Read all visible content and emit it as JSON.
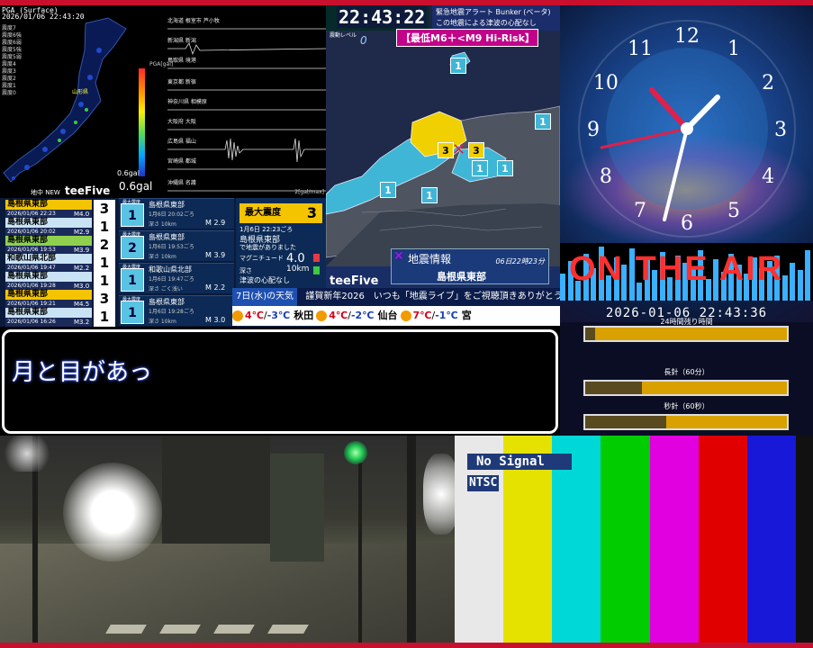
{
  "seismometer": {
    "title": "PGA (Surface)",
    "date": "2026/01/06 22:43:20",
    "legend": [
      "震度7",
      "震度6強",
      "震度6弱",
      "震度5強",
      "震度5弱",
      "震度4",
      "震度3",
      "震度2",
      "震度1",
      "震度0"
    ],
    "scale_label": "PGA[gal]",
    "gal_min": "0.6gal",
    "gal_main": "0.6gal",
    "map_label": "地中 NEW",
    "brand": "teeFive",
    "unit": "2[gal/max]",
    "stations": [
      "北海道 根室市 芦小牧",
      "新潟県 新潟",
      "鳥取県 境港",
      "東京都 新宿",
      "神奈川県 相模原",
      "大阪府 大阪",
      "広島県 福山",
      "宮崎県 都城",
      "沖縄県 名護"
    ]
  },
  "eq_list": [
    {
      "place": "島根県東部",
      "time": "2026/01/06 22:23",
      "mag": "M4.0",
      "intensity": "3",
      "color": "#f5c400"
    },
    {
      "place": "島根県東部",
      "time": "2026/01/06 20:02",
      "mag": "M2.9",
      "intensity": "1",
      "color": "#c9e3f5"
    },
    {
      "place": "島根県東部",
      "time": "2026/01/06 19:53",
      "mag": "M3.9",
      "intensity": "2",
      "color": "#8fd14f"
    },
    {
      "place": "和歌山県北部",
      "time": "2026/01/06 19:47",
      "mag": "M2.2",
      "intensity": "1",
      "color": "#c9e3f5"
    },
    {
      "place": "島根県東部",
      "time": "2026/01/06 19:28",
      "mag": "M3.0",
      "intensity": "1",
      "color": "#c9e3f5"
    },
    {
      "place": "島根県東部",
      "time": "2026/01/06 19:21",
      "mag": "M4.5",
      "intensity": "3",
      "color": "#f5c400"
    },
    {
      "place": "島根県東部",
      "time": "2026/01/06 16:26",
      "mag": "M3.2",
      "intensity": "1",
      "color": "#c9e3f5"
    }
  ],
  "cards": [
    {
      "label": "最大震度",
      "badge": "1",
      "place": "島根県東部",
      "time": "1月6日 20:02ごろ",
      "depth": "深さ  10km",
      "mag": "M 2.9"
    },
    {
      "label": "最大震度",
      "badge": "2",
      "place": "島根県東部",
      "time": "1月6日 19:53ごろ",
      "depth": "深さ  10km",
      "mag": "M 3.9"
    },
    {
      "label": "最大震度",
      "badge": "1",
      "place": "和歌山県北部",
      "time": "1月6日 19:47ごろ",
      "depth": "深さ ごく浅い",
      "mag": "M 2.2"
    },
    {
      "label": "最大震度",
      "badge": "1",
      "place": "島根県東部",
      "time": "1月6日 19:28ごろ",
      "depth": "深さ  10km",
      "mag": "M 3.0"
    }
  ],
  "max_box": {
    "header": "最大震度",
    "header_value": "3",
    "time": "1月6日 22:23ごろ",
    "place": "島根県東部",
    "note": "で地震がありました",
    "mag_label": "マグニチュード",
    "mag_value": "4.0",
    "depth_label": "深さ",
    "depth_value": "10km",
    "tsunami": "津波の心配なし"
  },
  "map_panel": {
    "clock": "22:43:22",
    "top_line1": "緊急地震アラート Bunker (ベータ)",
    "top_line2": "この地震による津波の心配なし",
    "level_label": "震動レベル",
    "level_value": "0",
    "risk": "【最低M6＋<M9 Hi-Risk】",
    "info_title": "地震情報",
    "info_date": "06日22時23分",
    "info_place": "島根県東部",
    "brand": "teeFive",
    "markers": [
      "1",
      "3",
      "3",
      "1",
      "1",
      "1",
      "1",
      "1"
    ]
  },
  "ticker": {
    "day": "7日(水)の天気",
    "message": "謹賀新年2026　いつも「地震ライブ」をご視聴頂きありがとうございます!",
    "weather": [
      {
        "city": "",
        "hi": "4℃",
        "lo": "-3℃"
      },
      {
        "city": "秋田",
        "hi": "4℃",
        "lo": "-2℃"
      },
      {
        "city": "仙台",
        "hi": "7℃",
        "lo": "-1℃"
      },
      {
        "city": "宮",
        "hi": "",
        "lo": ""
      }
    ]
  },
  "clock_panel": {
    "numbers": [
      "12",
      "1",
      "2",
      "3",
      "4",
      "5",
      "6",
      "7",
      "8",
      "9",
      "10",
      "11"
    ],
    "on_air": "ON THE AIR",
    "datetime": "2026-01-06  22:43:36",
    "remain_label": "24時間残り時間",
    "long_label": "長針（60分）",
    "second_label": "秒針（60秒）",
    "remain_fraction": 0.05,
    "long_fraction": 0.28,
    "second_fraction": 0.4
  },
  "caption": {
    "text": "月と目があっ"
  },
  "color_bars": {
    "no_signal": "No Signal",
    "ntsc": "NTSC",
    "colors": [
      "#e8e8e8",
      "#e6e200",
      "#00d8d8",
      "#00cc00",
      "#e000e0",
      "#e00000",
      "#1818d8",
      "#111111"
    ]
  }
}
